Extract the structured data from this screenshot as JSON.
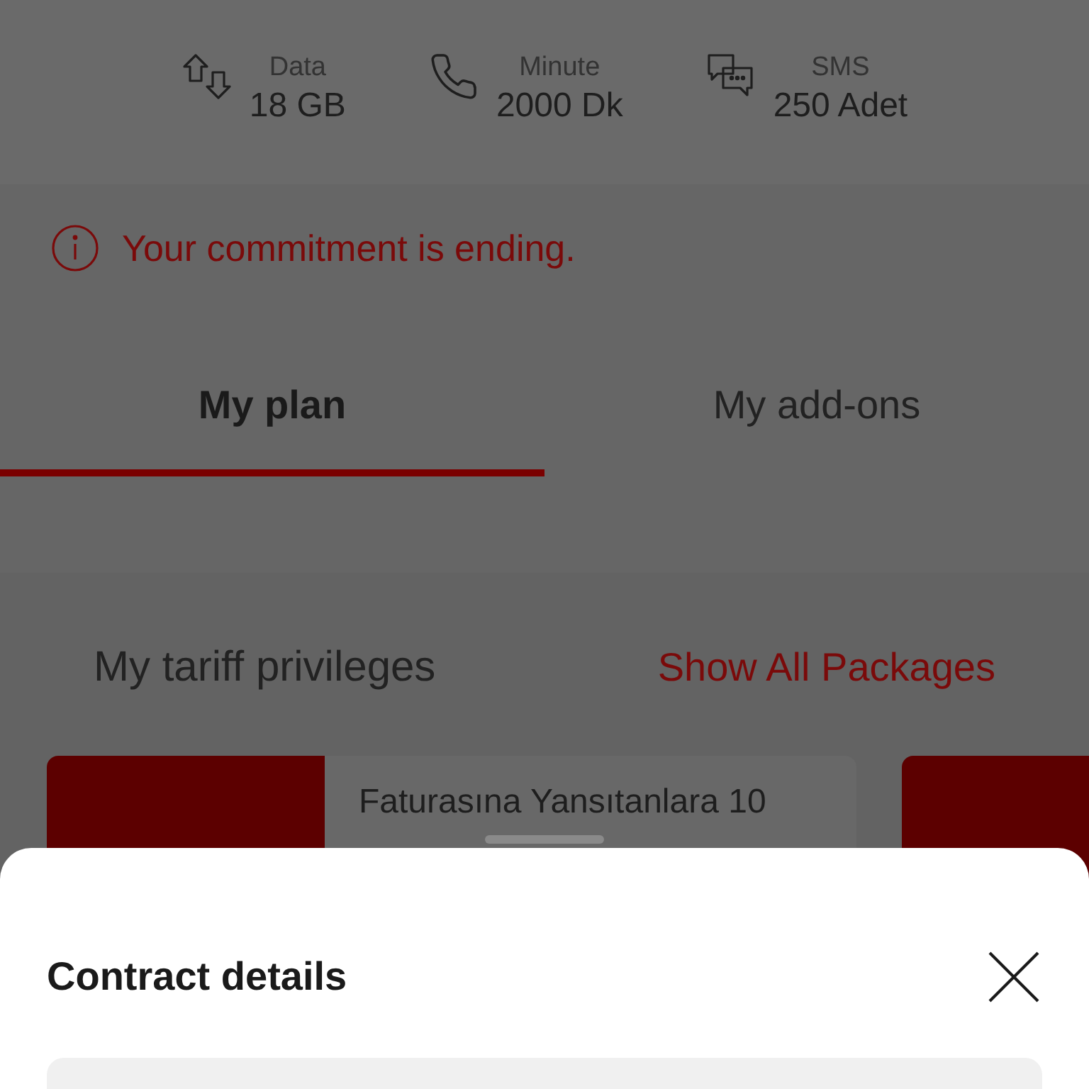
{
  "allowances": [
    {
      "kind": "data",
      "label": "Data",
      "value": "18 GB"
    },
    {
      "kind": "minute",
      "label": "Minute",
      "value": "2000 Dk"
    },
    {
      "kind": "sms",
      "label": "SMS",
      "value": "250 Adet"
    }
  ],
  "alert": {
    "text": "Your commitment is ending."
  },
  "tabs": [
    {
      "label": "My plan",
      "selected": true
    },
    {
      "label": "My add-ons",
      "selected": false
    }
  ],
  "privileges": {
    "title": "My tariff privileges",
    "link": "Show All Packages",
    "cards": [
      {
        "title": "Faturasına Yansıtanlara 10"
      }
    ]
  },
  "sheet": {
    "title": "Contract details"
  }
}
